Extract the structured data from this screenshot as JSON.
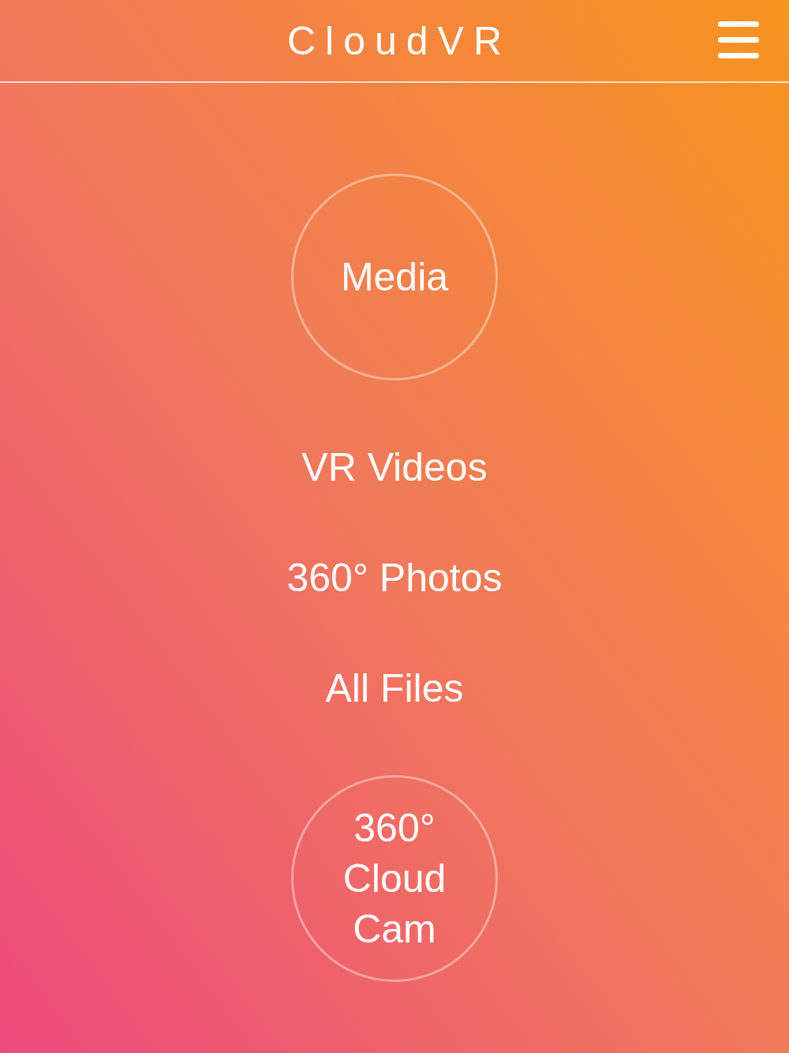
{
  "app_bar": {
    "title": "CloudVR"
  },
  "media_button": {
    "label": "Media"
  },
  "menu_items": [
    {
      "label": "VR Videos"
    },
    {
      "label": "360° Photos"
    },
    {
      "label": "All Files"
    }
  ],
  "cam_button": {
    "label": "360° Cloud Cam"
  }
}
